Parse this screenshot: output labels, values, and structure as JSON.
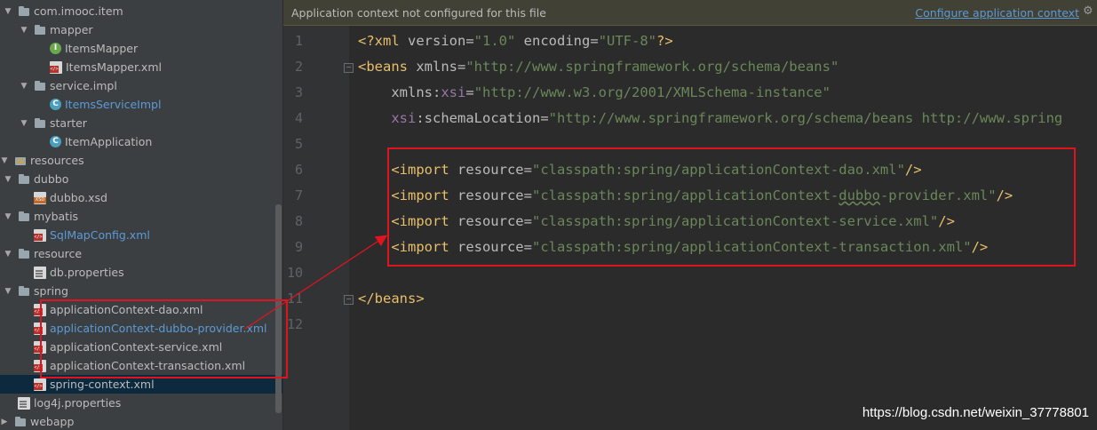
{
  "tree": {
    "items": [
      {
        "label": "com.imooc.item",
        "icon": "folder-icon",
        "arrow": "▼",
        "indent": 0
      },
      {
        "label": "mapper",
        "icon": "folder-icon",
        "arrow": "▼",
        "indent": 1
      },
      {
        "label": "ItemsMapper",
        "icon": "interface-icon",
        "arrow": "",
        "indent": 2
      },
      {
        "label": "ItemsMapper.xml",
        "icon": "xml-file-icon",
        "arrow": "",
        "indent": 2
      },
      {
        "label": "service.impl",
        "icon": "folder-icon",
        "arrow": "▼",
        "indent": 1
      },
      {
        "label": "ItemsServiceImpl",
        "icon": "class-icon",
        "arrow": "",
        "indent": 2,
        "color": "blue"
      },
      {
        "label": "starter",
        "icon": "folder-icon",
        "arrow": "▼",
        "indent": 1
      },
      {
        "label": "ItemApplication",
        "icon": "class-icon",
        "arrow": "",
        "indent": 2
      },
      {
        "label": "resources",
        "icon": "resources-folder-icon",
        "arrow": "▼",
        "indent": -1
      },
      {
        "label": "dubbo",
        "icon": "folder-icon",
        "arrow": "▼",
        "indent": 0
      },
      {
        "label": "dubbo.xsd",
        "icon": "xsd-file-icon",
        "arrow": "",
        "indent": 1
      },
      {
        "label": "mybatis",
        "icon": "folder-icon",
        "arrow": "▼",
        "indent": 0
      },
      {
        "label": "SqlMapConfig.xml",
        "icon": "xml-file-icon",
        "arrow": "",
        "indent": 1,
        "color": "blue"
      },
      {
        "label": "resource",
        "icon": "folder-icon",
        "arrow": "▼",
        "indent": 0
      },
      {
        "label": "db.properties",
        "icon": "properties-file-icon",
        "arrow": "",
        "indent": 1
      },
      {
        "label": "spring",
        "icon": "folder-icon",
        "arrow": "▼",
        "indent": 0
      },
      {
        "label": "applicationContext-dao.xml",
        "icon": "xml-file-icon",
        "arrow": "",
        "indent": 1
      },
      {
        "label": "applicationContext-dubbo-provider.xml",
        "icon": "xml-file-icon",
        "arrow": "",
        "indent": 1,
        "color": "blue"
      },
      {
        "label": "applicationContext-service.xml",
        "icon": "xml-file-icon",
        "arrow": "",
        "indent": 1
      },
      {
        "label": "applicationContext-transaction.xml",
        "icon": "xml-file-icon",
        "arrow": "",
        "indent": 1
      },
      {
        "label": "spring-context.xml",
        "icon": "xml-file-icon",
        "arrow": "",
        "indent": 1,
        "selected": true
      },
      {
        "label": "log4j.properties",
        "icon": "properties-file-icon",
        "arrow": "",
        "indent": 0
      },
      {
        "label": "webapp",
        "icon": "folder-icon",
        "arrow": "▶",
        "indent": -1
      }
    ]
  },
  "banner": {
    "message": "Application context not configured for this file",
    "link": "Configure application context",
    "gear": "⚙"
  },
  "editor": {
    "line_numbers": [
      "1",
      "2",
      "3",
      "4",
      "5",
      "6",
      "7",
      "8",
      "9",
      "10",
      "11",
      "12"
    ],
    "fold_lines": [
      2,
      11
    ],
    "lines": [
      [
        {
          "t": "<?xml ",
          "c": "pi"
        },
        {
          "t": "version",
          "c": "attr"
        },
        {
          "t": "=",
          "c": "attr"
        },
        {
          "t": "\"1.0\"",
          "c": "val"
        },
        {
          "t": " encoding",
          "c": "attr"
        },
        {
          "t": "=",
          "c": "attr"
        },
        {
          "t": "\"UTF-8\"",
          "c": "val"
        },
        {
          "t": "?>",
          "c": "pi"
        }
      ],
      [
        {
          "t": "<beans ",
          "c": "tag"
        },
        {
          "t": "xmlns",
          "c": "attr"
        },
        {
          "t": "=",
          "c": "attr"
        },
        {
          "t": "\"http://www.springframework.org/schema/beans\"",
          "c": "val"
        }
      ],
      [
        {
          "t": "    xmlns",
          "c": "attr"
        },
        {
          "t": ":",
          "c": "attr"
        },
        {
          "t": "xsi",
          "c": "ns"
        },
        {
          "t": "=",
          "c": "attr"
        },
        {
          "t": "\"http://www.w3.org/2001/XMLSchema-instance\"",
          "c": "val"
        }
      ],
      [
        {
          "t": "    ",
          "c": "attr"
        },
        {
          "t": "xsi",
          "c": "ns"
        },
        {
          "t": ":schemaLocation",
          "c": "attr"
        },
        {
          "t": "=",
          "c": "attr"
        },
        {
          "t": "\"http://www.springframework.org/schema/beans http://www.spring",
          "c": "val"
        }
      ],
      [],
      [
        {
          "t": "    <import ",
          "c": "tag"
        },
        {
          "t": "resource",
          "c": "attr"
        },
        {
          "t": "=",
          "c": "attr"
        },
        {
          "t": "\"classpath:spring/applicationContext-dao.xml\"",
          "c": "val"
        },
        {
          "t": "/>",
          "c": "tag"
        }
      ],
      [
        {
          "t": "    <import ",
          "c": "tag"
        },
        {
          "t": "resource",
          "c": "attr"
        },
        {
          "t": "=",
          "c": "attr"
        },
        {
          "t": "\"classpath:spring/applicationContext-",
          "c": "val"
        },
        {
          "t": "dubbo",
          "c": "val squig"
        },
        {
          "t": "-provider.xml\"",
          "c": "val"
        },
        {
          "t": "/>",
          "c": "tag"
        }
      ],
      [
        {
          "t": "    <import ",
          "c": "tag"
        },
        {
          "t": "resource",
          "c": "attr"
        },
        {
          "t": "=",
          "c": "attr"
        },
        {
          "t": "\"classpath:spring/applicationContext-service.xml\"",
          "c": "val"
        },
        {
          "t": "/>",
          "c": "tag"
        }
      ],
      [
        {
          "t": "    <import ",
          "c": "tag"
        },
        {
          "t": "resource",
          "c": "attr"
        },
        {
          "t": "=",
          "c": "attr"
        },
        {
          "t": "\"classpath:spring/applicationContext-transaction.xml\"",
          "c": "val"
        },
        {
          "t": "/>",
          "c": "tag"
        }
      ],
      [],
      [
        {
          "t": "</beans>",
          "c": "tag"
        }
      ],
      []
    ]
  },
  "watermark": "https://blog.csdn.net/weixin_37778801",
  "colors": {
    "annotation_red": "#e0141e",
    "tree_bg": "#3c3f41",
    "editor_bg": "#2b2b2b",
    "banner_bg": "#414135",
    "link_blue": "#5c9ad6"
  }
}
